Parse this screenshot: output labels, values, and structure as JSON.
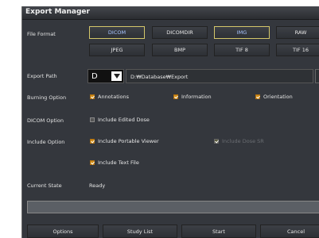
{
  "window": {
    "title": "Export Manager"
  },
  "labels": {
    "file_format": "File Format",
    "export_path": "Export Path",
    "burning_option": "Burning Option",
    "dicom_option": "DICOM Option",
    "include_option": "Include Option",
    "current_state": "Current State"
  },
  "file_formats": {
    "dicom": "DICOM",
    "dicomdir": "DICOMDIR",
    "img": "IMG",
    "raw": "RAW",
    "jpeg": "JPEG",
    "bmp": "BMP",
    "tif8": "TIF 8",
    "tif16": "TIF 16",
    "selected": [
      "DICOM",
      "IMG"
    ]
  },
  "export_path": {
    "drive": "D",
    "path": "D:₩Database₩Export"
  },
  "burning": {
    "annotations": "Annotations",
    "information": "Information",
    "orientation": "Orientation"
  },
  "dicom_option": {
    "include_edited_dose": "Include Edited Dose"
  },
  "include": {
    "portable_viewer": "Include Portable Viewer",
    "dose_sr": "Include Dose SR",
    "text_file": "Include Text File"
  },
  "state": {
    "value": "Ready"
  },
  "buttons": {
    "options": "Options",
    "study_list": "Study List",
    "start": "Start",
    "cancel": "Cancel"
  },
  "colors": {
    "accent_selected": "#d4c76a",
    "checkbox_on": "#d48f18",
    "background": "#34373d"
  }
}
